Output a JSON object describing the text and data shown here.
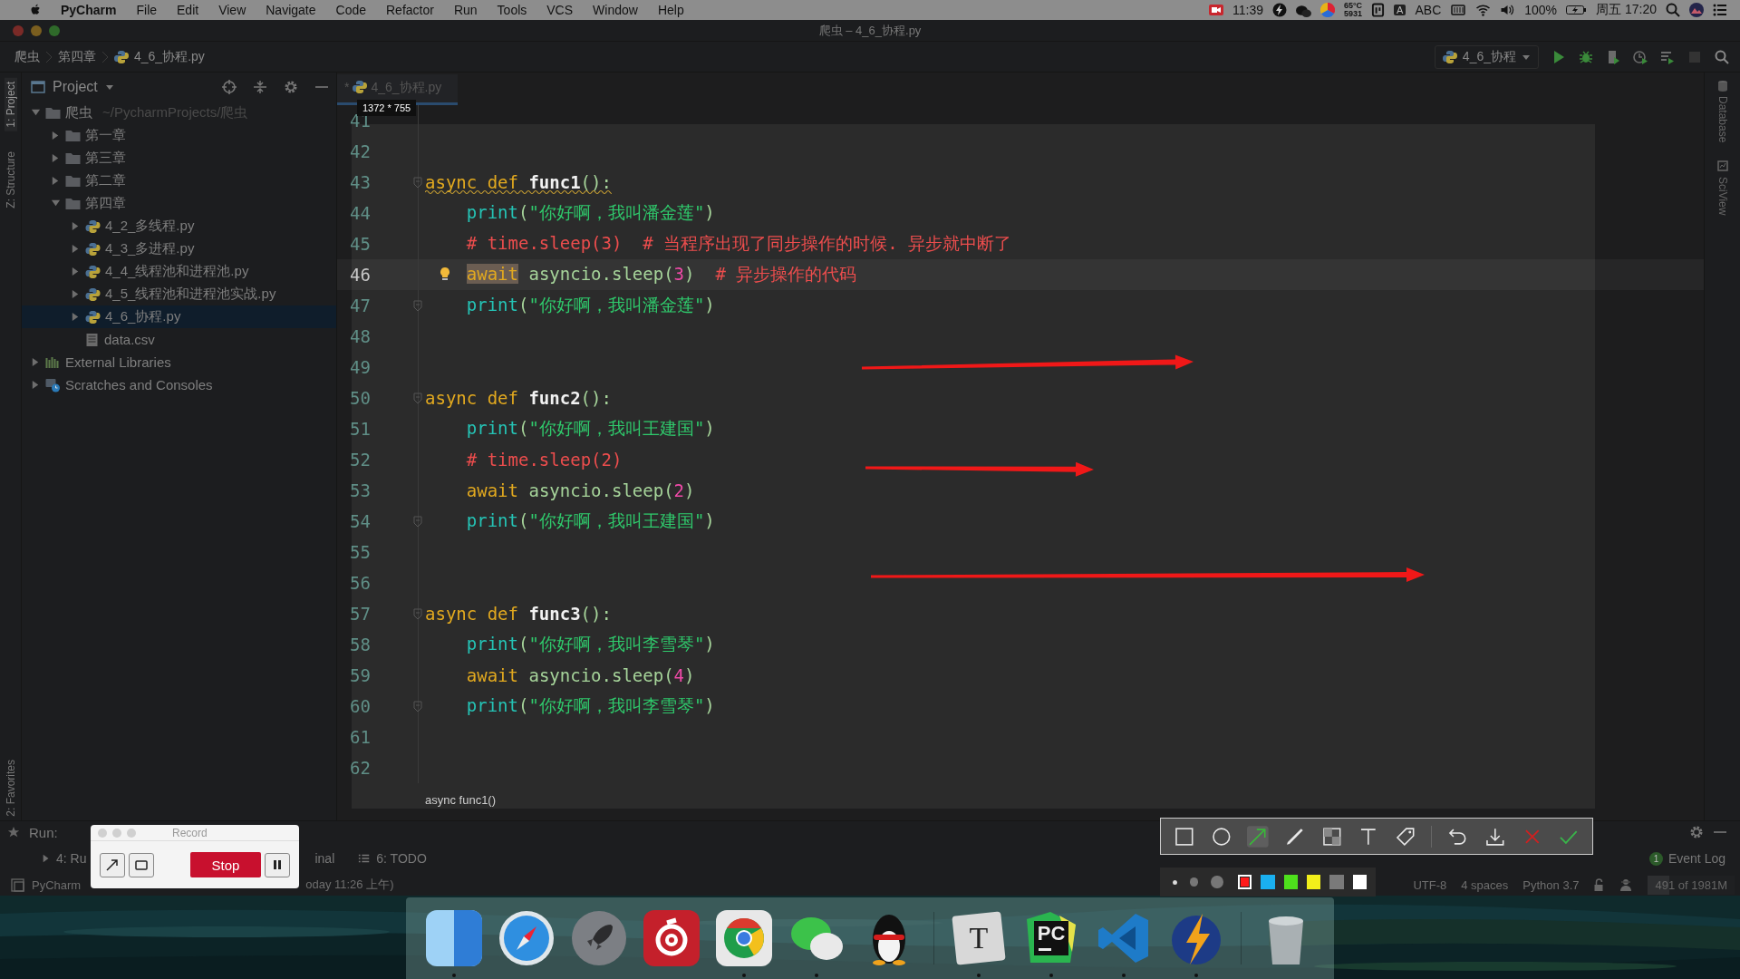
{
  "menubar": {
    "app": "PyCharm",
    "menus": [
      "File",
      "Edit",
      "View",
      "Navigate",
      "Code",
      "Refactor",
      "Run",
      "Tools",
      "VCS",
      "Window",
      "Help"
    ],
    "status": {
      "record_time": "11:39",
      "temperature": "65°C",
      "fan_speed": "5931",
      "input_mark": "A",
      "input_source": "ABC",
      "battery": "100%",
      "clock": "周五 17:20"
    }
  },
  "window": {
    "title": "爬虫 – 4_6_协程.py"
  },
  "navbar": {
    "breadcrumb": [
      "爬虫",
      "第四章",
      "4_6_协程.py"
    ],
    "run_config": "4_6_协程"
  },
  "left_tabs_top": [
    {
      "label": "1: Project",
      "selected": true
    },
    {
      "label": "Z: Structure",
      "selected": false
    }
  ],
  "left_tabs_bottom": [
    {
      "label": "2: Favorites",
      "selected": false
    }
  ],
  "right_tabs": [
    "Database",
    "SciView"
  ],
  "project": {
    "title": "Project",
    "tree": [
      {
        "label": "爬虫",
        "path": "~/PycharmProjects/爬虫",
        "kind": "folder",
        "expanded": true,
        "selected": false,
        "children": [
          {
            "label": "第一章",
            "kind": "folder",
            "expanded": false,
            "selected": false
          },
          {
            "label": "第三章",
            "kind": "folder",
            "expanded": false,
            "selected": false
          },
          {
            "label": "第二章",
            "kind": "folder",
            "expanded": false,
            "selected": false
          },
          {
            "label": "第四章",
            "kind": "folder",
            "expanded": true,
            "selected": false,
            "children": [
              {
                "label": "4_2_多线程.py",
                "kind": "py",
                "expanded": false,
                "selected": false
              },
              {
                "label": "4_3_多进程.py",
                "kind": "py",
                "expanded": false,
                "selected": false
              },
              {
                "label": "4_4_线程池和进程池.py",
                "kind": "py",
                "expanded": false,
                "selected": false
              },
              {
                "label": "4_5_线程池和进程池实战.py",
                "kind": "py",
                "expanded": false,
                "selected": false
              },
              {
                "label": "4_6_协程.py",
                "kind": "py",
                "expanded": false,
                "selected": true
              },
              {
                "label": "data.csv",
                "kind": "csv",
                "selected": false
              }
            ]
          }
        ]
      },
      {
        "label": "External Libraries",
        "kind": "libraries",
        "expanded": false,
        "selected": false
      },
      {
        "label": "Scratches and Consoles",
        "kind": "scratches",
        "expanded": false,
        "selected": false
      }
    ]
  },
  "editor": {
    "tab": {
      "prefix": "*",
      "label": "4_6_协程.py",
      "selected": true
    },
    "tooltip": "1372 * 755",
    "lines": [
      {
        "number": "41",
        "current": false,
        "warning": false,
        "fold": false,
        "bulb": false,
        "indented": false
      },
      {
        "number": "42",
        "current": false,
        "warning": false,
        "fold": false,
        "bulb": false,
        "indented": false
      },
      {
        "number": "43",
        "current": false,
        "warning": true,
        "fold": true,
        "bulb": false,
        "indented": false,
        "tokens": [
          {
            "text": "async ",
            "kind": "kw"
          },
          {
            "text": "def ",
            "kind": "kw"
          },
          {
            "text": "func1",
            "kind": "fn"
          },
          {
            "text": "():",
            "kind": "plain"
          }
        ]
      },
      {
        "number": "44",
        "current": false,
        "warning": false,
        "fold": false,
        "bulb": false,
        "indented": true,
        "tokens": [
          {
            "text": "print",
            "kind": "builtin"
          },
          {
            "text": "(",
            "kind": "plain"
          },
          {
            "text": "\"你好啊，我叫潘金莲\"",
            "kind": "str"
          },
          {
            "text": ")",
            "kind": "plain"
          }
        ]
      },
      {
        "number": "45",
        "current": false,
        "warning": false,
        "fold": false,
        "bulb": false,
        "indented": true,
        "tokens": [
          {
            "text": "# time.sleep(3)  # 当程序出现了同步操作的时候. 异步就中断了",
            "kind": "comment"
          }
        ]
      },
      {
        "number": "46",
        "current": true,
        "warning": false,
        "fold": false,
        "bulb": true,
        "indented": true,
        "tokens": [
          {
            "text": "await",
            "kind": "match"
          },
          {
            "text": " asyncio.sleep(",
            "kind": "plain"
          },
          {
            "text": "3",
            "kind": "num"
          },
          {
            "text": ")  ",
            "kind": "plain"
          },
          {
            "text": "# 异步操作的代码",
            "kind": "comment"
          }
        ]
      },
      {
        "number": "47",
        "current": false,
        "warning": false,
        "fold": true,
        "bulb": false,
        "indented": true,
        "tokens": [
          {
            "text": "print",
            "kind": "builtin"
          },
          {
            "text": "(",
            "kind": "plain"
          },
          {
            "text": "\"你好啊，我叫潘金莲\"",
            "kind": "str"
          },
          {
            "text": ")",
            "kind": "plain"
          }
        ]
      },
      {
        "number": "48",
        "current": false,
        "warning": false,
        "fold": false,
        "bulb": false,
        "indented": false
      },
      {
        "number": "49",
        "current": false,
        "warning": false,
        "fold": false,
        "bulb": false,
        "indented": false
      },
      {
        "number": "50",
        "current": false,
        "warning": false,
        "fold": true,
        "bulb": false,
        "indented": false,
        "tokens": [
          {
            "text": "async ",
            "kind": "kw"
          },
          {
            "text": "def ",
            "kind": "kw"
          },
          {
            "text": "func2",
            "kind": "fn"
          },
          {
            "text": "():",
            "kind": "plain"
          }
        ]
      },
      {
        "number": "51",
        "current": false,
        "warning": false,
        "fold": false,
        "bulb": false,
        "indented": true,
        "tokens": [
          {
            "text": "print",
            "kind": "builtin"
          },
          {
            "text": "(",
            "kind": "plain"
          },
          {
            "text": "\"你好啊，我叫王建国\"",
            "kind": "str"
          },
          {
            "text": ")",
            "kind": "plain"
          }
        ]
      },
      {
        "number": "52",
        "current": false,
        "warning": false,
        "fold": false,
        "bulb": false,
        "indented": true,
        "tokens": [
          {
            "text": "# time.sleep(2)",
            "kind": "comment"
          }
        ]
      },
      {
        "number": "53",
        "current": false,
        "warning": false,
        "fold": false,
        "bulb": false,
        "indented": true,
        "tokens": [
          {
            "text": "await ",
            "kind": "kw"
          },
          {
            "text": "asyncio.sleep(",
            "kind": "plain"
          },
          {
            "text": "2",
            "kind": "num"
          },
          {
            "text": ")",
            "kind": "plain"
          }
        ]
      },
      {
        "number": "54",
        "current": false,
        "warning": false,
        "fold": true,
        "bulb": false,
        "indented": true,
        "tokens": [
          {
            "text": "print",
            "kind": "builtin"
          },
          {
            "text": "(",
            "kind": "plain"
          },
          {
            "text": "\"你好啊，我叫王建国\"",
            "kind": "str"
          },
          {
            "text": ")",
            "kind": "plain"
          }
        ]
      },
      {
        "number": "55",
        "current": false,
        "warning": false,
        "fold": false,
        "bulb": false,
        "indented": false
      },
      {
        "number": "56",
        "current": false,
        "warning": false,
        "fold": false,
        "bulb": false,
        "indented": false
      },
      {
        "number": "57",
        "current": false,
        "warning": false,
        "fold": true,
        "bulb": false,
        "indented": false,
        "tokens": [
          {
            "text": "async ",
            "kind": "kw"
          },
          {
            "text": "def ",
            "kind": "kw"
          },
          {
            "text": "func3",
            "kind": "fn"
          },
          {
            "text": "():",
            "kind": "plain"
          }
        ]
      },
      {
        "number": "58",
        "current": false,
        "warning": false,
        "fold": false,
        "bulb": false,
        "indented": true,
        "tokens": [
          {
            "text": "print",
            "kind": "builtin"
          },
          {
            "text": "(",
            "kind": "plain"
          },
          {
            "text": "\"你好啊，我叫李雪琴\"",
            "kind": "str"
          },
          {
            "text": ")",
            "kind": "plain"
          }
        ]
      },
      {
        "number": "59",
        "current": false,
        "warning": false,
        "fold": false,
        "bulb": false,
        "indented": true,
        "tokens": [
          {
            "text": "await ",
            "kind": "kw"
          },
          {
            "text": "asyncio.sleep(",
            "kind": "plain"
          },
          {
            "text": "4",
            "kind": "num"
          },
          {
            "text": ")",
            "kind": "plain"
          }
        ]
      },
      {
        "number": "60",
        "current": false,
        "warning": false,
        "fold": true,
        "bulb": false,
        "indented": true,
        "tokens": [
          {
            "text": "print",
            "kind": "builtin"
          },
          {
            "text": "(",
            "kind": "plain"
          },
          {
            "text": "\"你好啊，我叫李雪琴\"",
            "kind": "str"
          },
          {
            "text": ")",
            "kind": "plain"
          }
        ]
      },
      {
        "number": "61",
        "current": false,
        "warning": false,
        "fold": false,
        "bulb": false,
        "indented": false
      },
      {
        "number": "62",
        "current": false,
        "warning": false,
        "fold": false,
        "bulb": false,
        "indented": false
      }
    ],
    "breadcrumb": "async func1()"
  },
  "run_panel": {
    "label": "Run:"
  },
  "tool_tabs": [
    {
      "label": "4: Ru",
      "kind": "run"
    },
    {
      "label": "inal",
      "kind": "plain"
    },
    {
      "label": "6: TODO",
      "kind": "list"
    }
  ],
  "event_log": {
    "count": "1",
    "label": "Event Log"
  },
  "status_bar": {
    "message_start": "PyCharm",
    "message_end": "oday 11:26 上午)",
    "encoding": "UTF-8",
    "indent": "4 spaces",
    "interpreter": "Python 3.7",
    "memory": {
      "text": "491 of 1981M",
      "level": 0.25
    }
  },
  "record_widget": {
    "title": "Record",
    "stop": "Stop"
  },
  "annotation_toolbar": {
    "tools": [
      {
        "kind": "rect",
        "selected": false
      },
      {
        "kind": "ellipse",
        "selected": false
      },
      {
        "kind": "arrow",
        "selected": true
      },
      {
        "kind": "pen",
        "selected": false
      },
      {
        "kind": "mosaic",
        "selected": false
      },
      {
        "kind": "text",
        "selected": false
      },
      {
        "kind": "tag",
        "selected": false
      }
    ],
    "actions": [
      {
        "kind": "undo"
      },
      {
        "kind": "save"
      },
      {
        "kind": "cancel"
      },
      {
        "kind": "confirm"
      }
    ],
    "sizes": [
      {
        "kind": "small",
        "selected": true
      },
      {
        "kind": "medium",
        "selected": false
      },
      {
        "kind": "large",
        "selected": false
      }
    ],
    "colors": [
      {
        "color": "#ff1a1a",
        "selected": true
      },
      {
        "color": "#1ab0f0",
        "selected": false
      },
      {
        "color": "#4ee11c",
        "selected": false
      },
      {
        "color": "#f2ef1a",
        "selected": false
      },
      {
        "color": "#7a7a7a",
        "selected": false
      },
      {
        "color": "#ffffff",
        "selected": false
      }
    ]
  },
  "annotations": [
    {
      "kind": "arrow"
    },
    {
      "kind": "arrow"
    },
    {
      "kind": "arrow"
    }
  ],
  "desktop": {
    "kind": "picture"
  },
  "dock": [
    {
      "kind": "finder",
      "running": true
    },
    {
      "kind": "safari",
      "running": false
    },
    {
      "kind": "rocket",
      "running": false
    },
    {
      "kind": "music",
      "running": false
    },
    {
      "kind": "chrome",
      "running": true
    },
    {
      "kind": "chat",
      "running": true
    },
    {
      "kind": "penguin",
      "running": false
    },
    {
      "kind": "editor_t",
      "glyph": "T",
      "running": true
    },
    {
      "kind": "ide_pc",
      "glyph": "PC",
      "running": true
    },
    {
      "kind": "vscode",
      "running": true
    },
    {
      "kind": "bolt",
      "running": true
    },
    {
      "kind": "trash",
      "running": false
    }
  ]
}
